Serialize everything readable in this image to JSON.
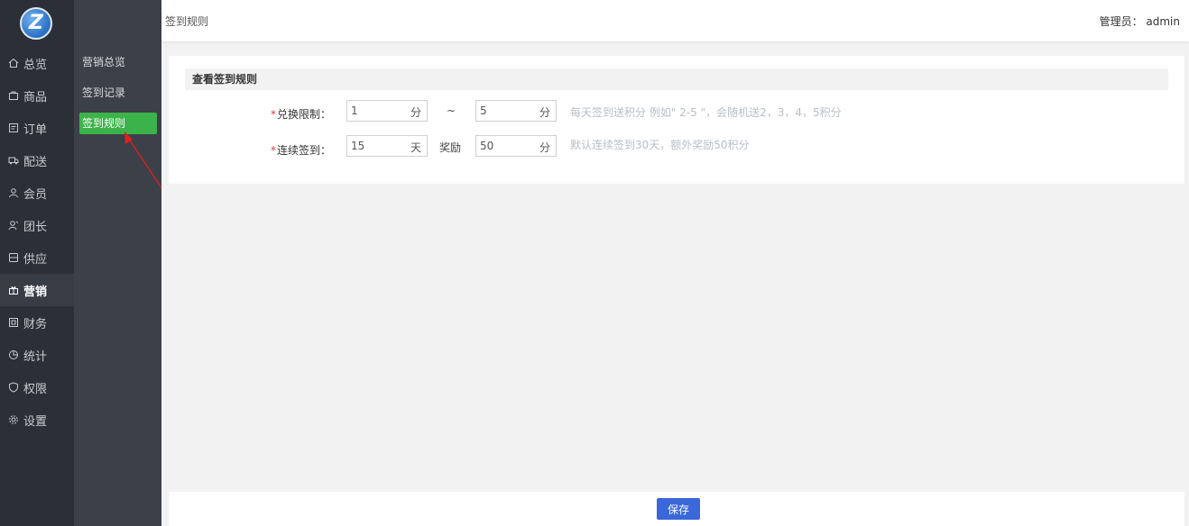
{
  "logo": {
    "letter": "Z"
  },
  "primary_nav": [
    {
      "label": "总览",
      "icon": "home-icon"
    },
    {
      "label": "商品",
      "icon": "goods-icon"
    },
    {
      "label": "订单",
      "icon": "order-icon"
    },
    {
      "label": "配送",
      "icon": "delivery-icon"
    },
    {
      "label": "会员",
      "icon": "member-icon"
    },
    {
      "label": "团长",
      "icon": "leader-icon"
    },
    {
      "label": "供应",
      "icon": "supply-icon"
    },
    {
      "label": "营销",
      "icon": "gift-icon",
      "active": true
    },
    {
      "label": "财务",
      "icon": "finance-icon"
    },
    {
      "label": "统计",
      "icon": "chart-icon"
    },
    {
      "label": "权限",
      "icon": "shield-icon"
    },
    {
      "label": "设置",
      "icon": "gear-icon"
    }
  ],
  "secondary_nav": [
    {
      "label": "营销总览"
    },
    {
      "label": "签到记录"
    },
    {
      "label": "签到规则",
      "active": true
    }
  ],
  "header": {
    "breadcrumb": "签到规则",
    "user": "管理员： admin"
  },
  "form": {
    "section_title": "查看签到规则",
    "exchange": {
      "required": "*",
      "label": "兑换限制：",
      "min_value": "1",
      "min_unit": "分",
      "separator": "~",
      "max_value": "5",
      "max_unit": "分",
      "hint": "每天签到送积分 例如\" 2-5 \"，会随机送2，3，4，5积分"
    },
    "streak": {
      "required": "*",
      "label": "连续签到：",
      "days_value": "15",
      "days_unit": "天",
      "reward_label": "奖励",
      "points_value": "50",
      "points_unit": "分",
      "hint": "默认连续签到30天，额外奖励50积分"
    }
  },
  "footer": {
    "save_label": "保存"
  },
  "colors": {
    "active_green": "#3cb34a",
    "save_blue": "#3a68d8",
    "required_red": "#e03a3a",
    "arrow_red": "#e02020"
  }
}
